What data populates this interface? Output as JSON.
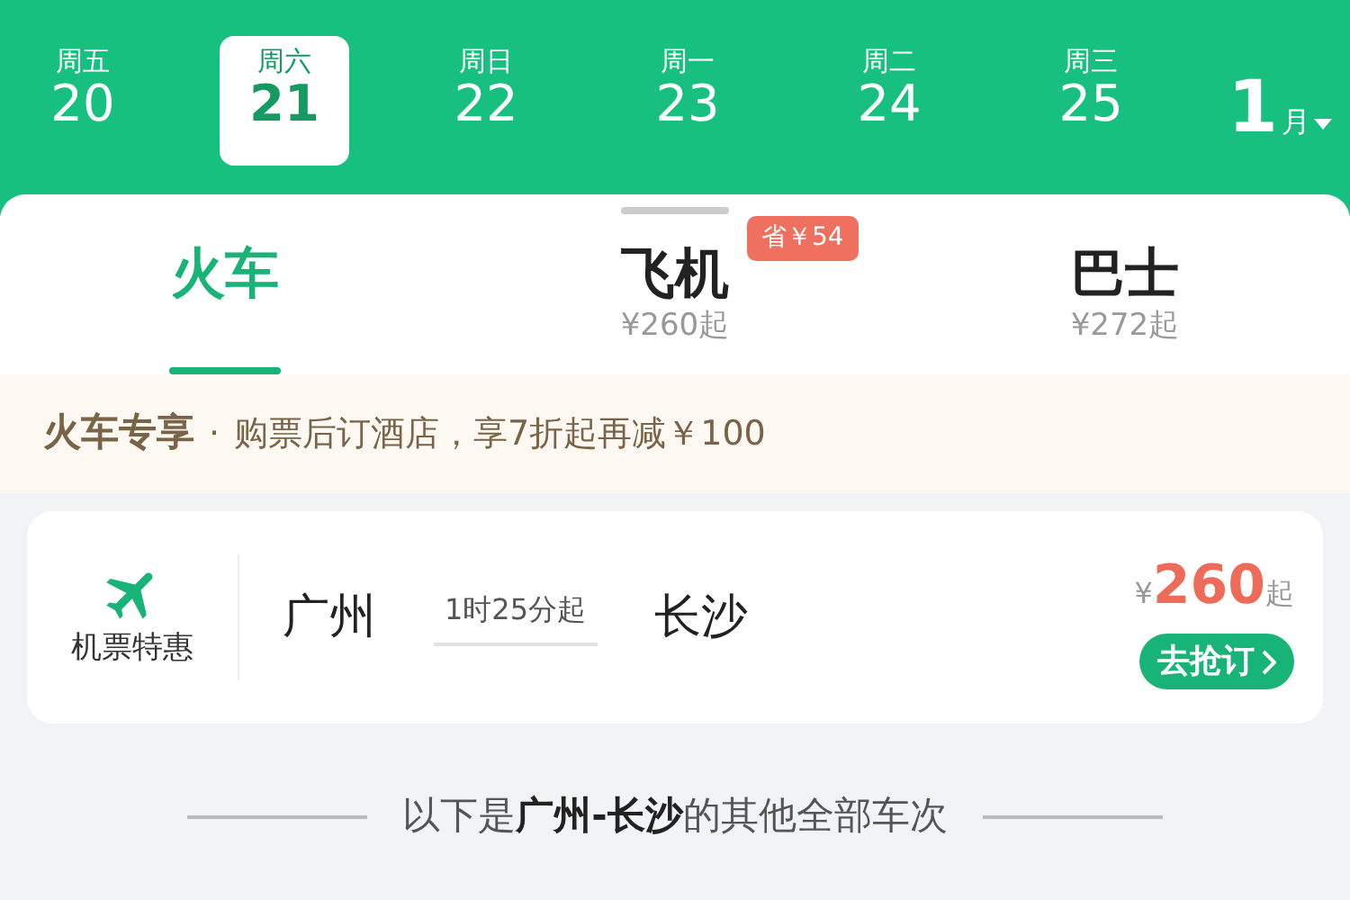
{
  "dates": [
    {
      "weekday": "周五",
      "day": "20",
      "selected": false
    },
    {
      "weekday": "周六",
      "day": "21",
      "selected": true
    },
    {
      "weekday": "周日",
      "day": "22",
      "selected": false
    },
    {
      "weekday": "周一",
      "day": "23",
      "selected": false
    },
    {
      "weekday": "周二",
      "day": "24",
      "selected": false
    },
    {
      "weekday": "周三",
      "day": "25",
      "selected": false
    }
  ],
  "month": {
    "number": "1",
    "unit": "月"
  },
  "tabs": [
    {
      "label": "火车",
      "selected": true
    },
    {
      "label": "飞机",
      "price": "¥260起",
      "badge": "省￥54",
      "selected": false
    },
    {
      "label": "巴士",
      "price": "¥272起",
      "selected": false
    }
  ],
  "promo": {
    "title": "火车专享",
    "separator": "·",
    "text": "购票后订酒店，享7折起再减￥100"
  },
  "flight_card": {
    "label": "机票特惠",
    "from": "广州",
    "duration": "1时25分起",
    "to": "长沙",
    "currency": "¥",
    "amount": "260",
    "suffix": "起",
    "button": "去抢订"
  },
  "divider_text": "以下是**广州-长沙**的其他全部车次"
}
